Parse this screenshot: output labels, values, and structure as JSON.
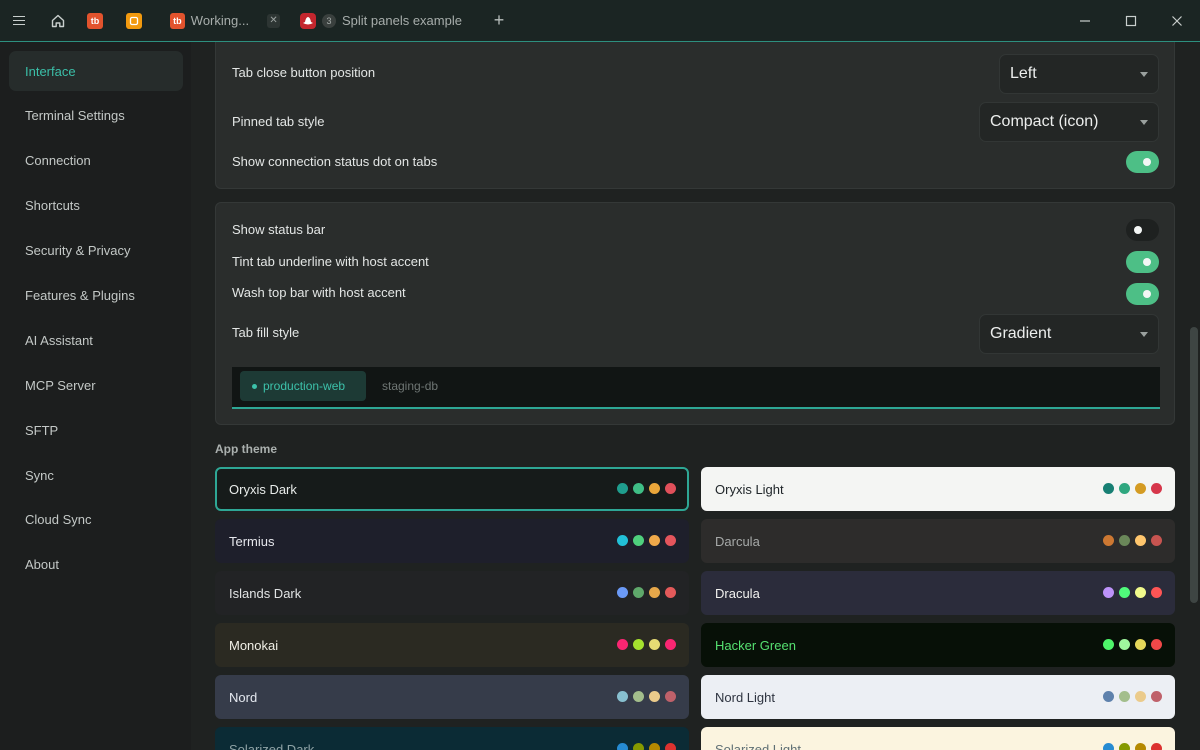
{
  "titlebar": {
    "tabs": [
      {
        "icon": "home-icon"
      },
      {
        "icon": "app-logo-icon",
        "letters": "tb"
      },
      {
        "icon": "app-logo-yellow-icon"
      },
      {
        "icon": "app-logo-icon",
        "letters": "tb",
        "label": "Working...",
        "close": "✕"
      },
      {
        "icon": "redhat-icon",
        "badge": "3",
        "label": "Split panels example"
      }
    ],
    "add_tab": "+",
    "window": {
      "minimize": "—",
      "maximize": "☐",
      "close": "✕"
    }
  },
  "sidebar": {
    "items": [
      {
        "label": "Interface",
        "active": true
      },
      {
        "label": "Terminal Settings"
      },
      {
        "label": "Connection"
      },
      {
        "label": "Shortcuts"
      },
      {
        "label": "Security & Privacy"
      },
      {
        "label": "Features & Plugins"
      },
      {
        "label": "AI Assistant"
      },
      {
        "label": "MCP Server"
      },
      {
        "label": "SFTP"
      },
      {
        "label": "Sync"
      },
      {
        "label": "Cloud Sync"
      },
      {
        "label": "About"
      }
    ]
  },
  "tabs_card": {
    "close_button_position": {
      "label": "Tab close button position",
      "value": "Left"
    },
    "pinned_tab_style": {
      "label": "Pinned tab style",
      "value": "Compact (icon)"
    },
    "status_dot": {
      "label": "Show connection status dot on tabs",
      "enabled": true
    }
  },
  "bar_card": {
    "status_bar": {
      "label": "Show status bar",
      "enabled": false
    },
    "tint_underline": {
      "label": "Tint tab underline with host accent",
      "enabled": true
    },
    "wash_top_bar": {
      "label": "Wash top bar with host accent",
      "enabled": true
    },
    "fill_style": {
      "label": "Tab fill style",
      "value": "Gradient"
    },
    "preview": {
      "active_tab": "production-web",
      "inactive_tab": "staging-db"
    }
  },
  "app_theme": {
    "heading": "App theme",
    "selected": "Oryxis Dark",
    "themes": [
      {
        "name": "Oryxis Dark",
        "bg": "#161b1a",
        "fg": "#e8ecea",
        "swatches": [
          "#1f9e8e",
          "#3fbe86",
          "#eaa63a",
          "#e0505a"
        ]
      },
      {
        "name": "Oryxis Light",
        "bg": "#f4f5f3",
        "fg": "#20262a",
        "swatches": [
          "#177f73",
          "#2fa77f",
          "#d49b22",
          "#d6364a"
        ]
      },
      {
        "name": "Termius",
        "bg": "#1e1f2b",
        "fg": "#e6e7ec",
        "swatches": [
          "#22c0d8",
          "#4fd07d",
          "#f0a94a",
          "#e5555c"
        ]
      },
      {
        "name": "Darcula",
        "bg": "#2d2c2b",
        "fg": "#a6a9a8",
        "swatches": [
          "#cc7832",
          "#6a8759",
          "#ffc66d",
          "#c75450"
        ]
      },
      {
        "name": "Islands Dark",
        "bg": "#222325",
        "fg": "#e1e3e4",
        "swatches": [
          "#6b9af7",
          "#5fa86b",
          "#e6a74a",
          "#e45a5a"
        ]
      },
      {
        "name": "Dracula",
        "bg": "#2b2c3b",
        "fg": "#f2f2f0",
        "swatches": [
          "#bd93f9",
          "#50fa7b",
          "#f1fa8c",
          "#ff5555"
        ]
      },
      {
        "name": "Monokai",
        "bg": "#2b2a22",
        "fg": "#f0efe6",
        "swatches": [
          "#f92672",
          "#a6e22e",
          "#e6db74",
          "#f92672"
        ]
      },
      {
        "name": "Hacker Green",
        "bg": "#071007",
        "fg": "#55e070",
        "swatches": [
          "#4ef56a",
          "#9ff79e",
          "#e5d85a",
          "#f04848"
        ]
      },
      {
        "name": "Nord",
        "bg": "#363c4a",
        "fg": "#e5e9f0",
        "swatches": [
          "#88c0d0",
          "#a3be8c",
          "#ebcb8b",
          "#bf616a"
        ]
      },
      {
        "name": "Nord Light",
        "bg": "#eceff4",
        "fg": "#2e3440",
        "swatches": [
          "#5e81ac",
          "#a3be8c",
          "#ebcb8b",
          "#bf616a"
        ]
      },
      {
        "name": "Solarized Dark",
        "bg": "#0b2b35",
        "fg": "#8fa3a6",
        "swatches": [
          "#268bd2",
          "#859900",
          "#b58900",
          "#dc322f"
        ]
      },
      {
        "name": "Solarized Light",
        "bg": "#fbf4df",
        "fg": "#5f6f74",
        "swatches": [
          "#268bd2",
          "#859900",
          "#b58900",
          "#dc322f"
        ]
      }
    ]
  }
}
